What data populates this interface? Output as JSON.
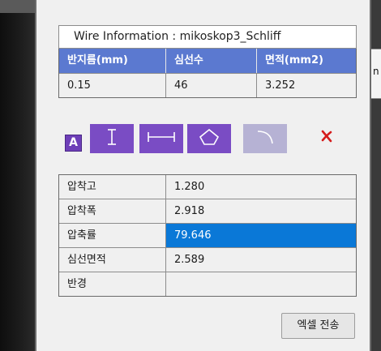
{
  "wire_info": {
    "title": "Wire Information : mikoskop3_Schliff",
    "headers": [
      "반지름(mm)",
      "심선수",
      "면적(mm2)"
    ],
    "values": [
      "0.15",
      "46",
      "3.252"
    ],
    "header_color": "#5b79d0"
  },
  "toolbar": {
    "mode_label": "A",
    "tools": [
      {
        "icon": "text-cursor-icon",
        "enabled": true
      },
      {
        "icon": "horizontal-measure-icon",
        "enabled": true
      },
      {
        "icon": "polygon-icon",
        "enabled": true
      },
      {
        "icon": "arc-icon",
        "enabled": false
      }
    ],
    "clear_icon": "red-x-icon",
    "accent": "#7a4cc4"
  },
  "measurements": {
    "rows": [
      {
        "label": "압착고",
        "value": "1.280"
      },
      {
        "label": "압착폭",
        "value": "2.918"
      },
      {
        "label": "압축률",
        "value": "79.646",
        "selected": true
      },
      {
        "label": "심선면적",
        "value": "2.589"
      },
      {
        "label": "반경",
        "value": ""
      }
    ],
    "selection_color": "#0a78d7"
  },
  "export_button": {
    "label": "엑셀 전송"
  },
  "side_fragment": {
    "text": "n"
  }
}
